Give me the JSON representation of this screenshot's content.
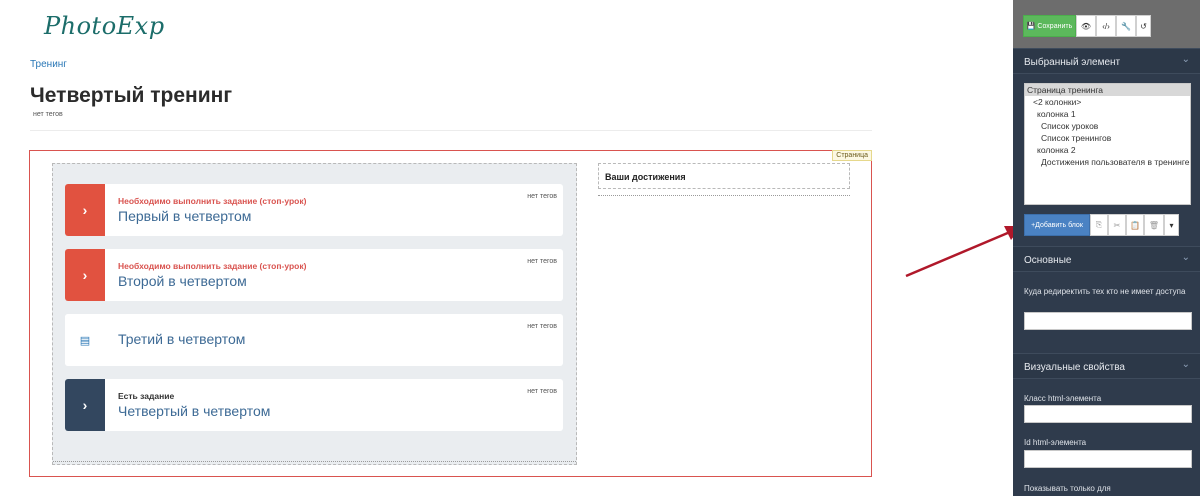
{
  "logo": {
    "text": "PhotoExp"
  },
  "breadcrumb": "Тренинг",
  "page": {
    "title": "Четвертый тренинг",
    "tags": "нет тегов"
  },
  "canvas": {
    "label": "Страница"
  },
  "lessons": [
    {
      "status": "Необходимо выполнить задание (стоп-урок)",
      "title": "Первый в четвертом",
      "tags": "нет тегов",
      "icon": "chevron-right-icon",
      "icon_glyph": "›",
      "style": "red"
    },
    {
      "status": "Необходимо выполнить задание (стоп-урок)",
      "title": "Второй в четвертом",
      "tags": "нет тегов",
      "icon": "chevron-right-icon",
      "icon_glyph": "›",
      "style": "red"
    },
    {
      "status": "",
      "title": "Третий в четвертом",
      "tags": "нет тегов",
      "icon": "document-icon",
      "icon_glyph": "▤",
      "style": "plain"
    },
    {
      "status": "Есть задание",
      "title": "Четвертый в четвертом",
      "tags": "нет тегов",
      "icon": "chevron-right-icon",
      "icon_glyph": "›",
      "style": "dark"
    }
  ],
  "achievements": {
    "title": "Ваши достижения"
  },
  "panel": {
    "toolbar": {
      "save_label": "💾 Сохранить",
      "preview_glyph": "👁",
      "code_glyph": "‹/›",
      "tools_glyph": "🔧",
      "undo_glyph": "↺"
    },
    "selected_section": "Выбранный элемент",
    "tree": [
      {
        "label": "Страница тренинга",
        "indent": 0,
        "selected": true
      },
      {
        "label": "<2 колонки>",
        "indent": 1,
        "selected": false
      },
      {
        "label": "колонка 1",
        "indent": 2,
        "selected": false
      },
      {
        "label": "Список уроков",
        "indent": 3,
        "selected": false
      },
      {
        "label": "Список тренингов",
        "indent": 3,
        "selected": false
      },
      {
        "label": "колонка 2",
        "indent": 2,
        "selected": false
      },
      {
        "label": "Достижения пользователя в тренинге",
        "indent": 3,
        "selected": false
      }
    ],
    "actions": {
      "add_block_label": "+Добавить блок",
      "copy_glyph": "⎘",
      "cut_glyph": "✂",
      "paste_glyph": "📋",
      "delete_glyph": "🗑",
      "more_glyph": "▾"
    },
    "main_section": "Основные",
    "redirect_label": "Куда редиректить тех кто не имеет доступа",
    "redirect_value": "",
    "visual_section": "Визуальные свойства",
    "class_label": "Класс html-элемента",
    "class_value": "",
    "id_label": "Id html-элемента",
    "id_value": "",
    "show_only_label": "Показывать только для"
  },
  "colors": {
    "danger": "#d9534f",
    "save_green": "#5cb85c",
    "add_blue": "#4a82c3",
    "panel_bg": "#2f3b4c",
    "arrow": "#b0182a"
  }
}
